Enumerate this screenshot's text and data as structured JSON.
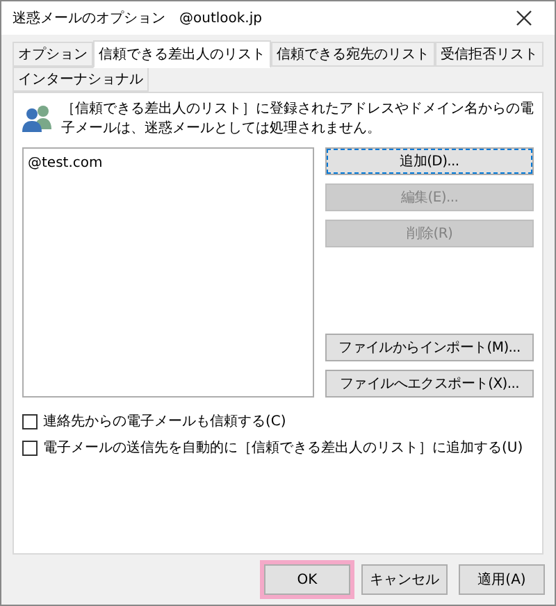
{
  "window": {
    "title": "迷惑メールのオプション",
    "account": "@outlook.jp"
  },
  "tabs": [
    {
      "label": "オプション",
      "selected": false
    },
    {
      "label": "信頼できる差出人のリスト",
      "selected": true
    },
    {
      "label": "信頼できる宛先のリスト",
      "selected": false
    },
    {
      "label": "受信拒否リスト",
      "selected": false
    },
    {
      "label": "インターナショナル",
      "selected": false
    }
  ],
  "description": "［信頼できる差出人のリスト］に登録されたアドレスやドメイン名からの電子メールは、迷惑メールとしては処理されません。",
  "list": {
    "items": [
      {
        "text": "@test.com"
      }
    ]
  },
  "side_buttons": [
    {
      "label": "追加(D)...",
      "disabled": false,
      "focused": true
    },
    {
      "label": "編集(E)...",
      "disabled": true,
      "focused": false
    },
    {
      "label": "削除(R)",
      "disabled": true,
      "focused": false
    },
    {
      "label": "ファイルからインポート(M)...",
      "disabled": false,
      "focused": false
    },
    {
      "label": "ファイルへエクスポート(X)...",
      "disabled": false,
      "focused": false
    }
  ],
  "checkboxes": [
    {
      "label": "連絡先からの電子メールも信頼する(C)",
      "checked": false
    },
    {
      "label": "電子メールの送信先を自動的に［信頼できる差出人のリスト］に追加する(U)",
      "checked": false
    }
  ],
  "footer_buttons": [
    {
      "label": "OK",
      "highlighted": true
    },
    {
      "label": "キャンセル",
      "highlighted": false
    },
    {
      "label": "適用(A)",
      "highlighted": false
    }
  ]
}
